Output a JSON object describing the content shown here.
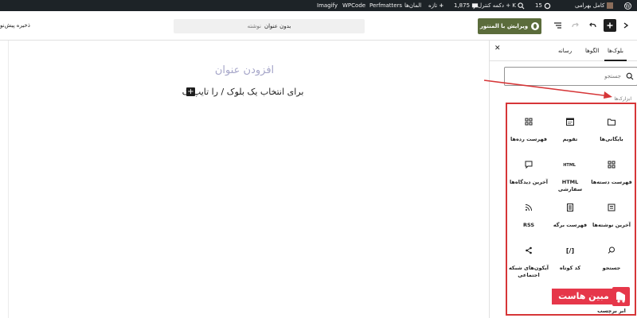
{
  "admin_bar": {
    "user_name": "کامل بهرامی",
    "updates_count": "15",
    "command_label": "دکمه کنترل + K",
    "comments_count": "1,875",
    "new_label": "تازه",
    "elements_label": "المان‌ها",
    "perfmatters": "Perfmatters",
    "wpcode": "WPCode",
    "imagify": "Imagify"
  },
  "header": {
    "publish_label": "ویرایش با المنتور",
    "doc_title": "بدون عنوان",
    "doc_type": "نوشته",
    "save_draft_label": "ذخیره پیش‌نو"
  },
  "canvas": {
    "add_title_placeholder": "افزودن عنوان",
    "appender_text": "برای انتخاب یک بلوک / را تایپ ک"
  },
  "sidebar": {
    "tabs": [
      "بلوک‌ها",
      "الگوها",
      "رسانه"
    ],
    "search_placeholder": "جستجو",
    "category_label": "ابزارک‌ها",
    "blocks": [
      {
        "label": "بایگانی‌ها",
        "icon": "archive-icon"
      },
      {
        "label": "تقویم",
        "icon": "calendar-icon"
      },
      {
        "label": "فهرست رده‌ها",
        "icon": "categories-icon"
      },
      {
        "label": "فهرست دسته‌ها",
        "icon": "categories-list-icon"
      },
      {
        "label": "HTML سفارشی",
        "icon": "html-icon",
        "icon_text": "HTML"
      },
      {
        "label": "آخرین دیدگاه‌ها",
        "icon": "comment-icon"
      },
      {
        "label": "آخرین نوشته‌ها",
        "icon": "latest-posts-icon"
      },
      {
        "label": "فهرست برگه",
        "icon": "page-list-icon"
      },
      {
        "label": "RSS",
        "icon": "rss-icon"
      },
      {
        "label": "جستجو",
        "icon": "search-icon"
      },
      {
        "label": "کد کوتاه",
        "icon": "shortcode-icon",
        "icon_text": "[/]"
      },
      {
        "label": "آیکون‌های شبکه اجتماعی",
        "icon": "share-icon"
      },
      {
        "label": "ابر برچسب",
        "icon": "tag-cloud-icon"
      }
    ]
  },
  "brand": {
    "text": "مبین هاست"
  },
  "colors": {
    "admin_bar": "#1d2327",
    "publish_button": "#5b6c3b",
    "annotation_red": "#d63638",
    "brand_red": "#e6374a",
    "title_placeholder": "#a6a6c9"
  }
}
